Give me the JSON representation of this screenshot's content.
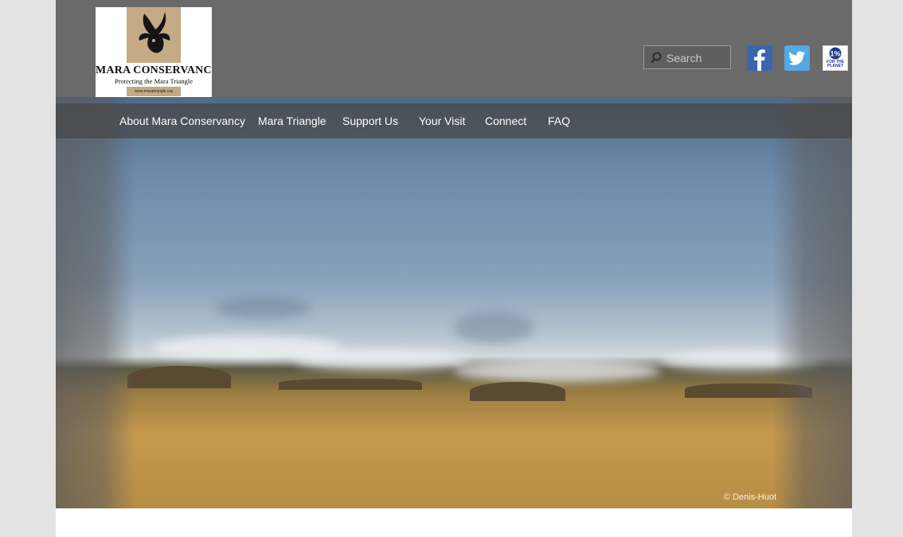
{
  "header": {
    "logo": {
      "title": "MARA CONSERVANCY",
      "tagline": "Protecting the Mara Triangle",
      "url": "www.maratriangle.org"
    },
    "search": {
      "placeholder": "Search",
      "icon": "search-icon"
    },
    "social": [
      {
        "name": "facebook",
        "icon": "facebook-icon",
        "label": "f"
      },
      {
        "name": "twitter",
        "icon": "twitter-icon"
      },
      {
        "name": "1% for the planet",
        "icon": "one-percent-planet-icon",
        "label": "FOR THE PLANET"
      }
    ]
  },
  "nav": {
    "items": [
      {
        "label": "About Mara Conservancy"
      },
      {
        "label": "Mara Triangle"
      },
      {
        "label": "Support Us"
      },
      {
        "label": "Your Visit"
      },
      {
        "label": "Connect"
      },
      {
        "label": "FAQ"
      }
    ]
  },
  "hero": {
    "credit": "© Denis-Huot"
  },
  "colors": {
    "header_bg": "#6a6a6a",
    "page_bg": "#e3e3e3",
    "facebook": "#3a66b0",
    "twitter": "#55a8e6"
  }
}
